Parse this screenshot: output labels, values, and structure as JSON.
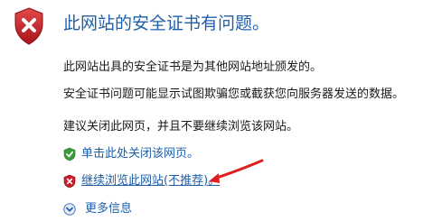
{
  "dialog": {
    "heading": "此网站的安全证书有问题。",
    "paragraphs": [
      "此网站出具的安全证书是为其他网站地址颁发的。",
      "安全证书问题可能显示试图欺骗您或截获您向服务器发送的数据。",
      "建议关闭此网页，并且不要继续浏览该网站。"
    ],
    "links": {
      "close_page": "单击此处关闭该网页。",
      "continue_site": "继续浏览此网站(不推荐)。",
      "more_info": "更多信息"
    }
  },
  "icons": {
    "banner": "shield-error-icon",
    "close_link": "shield-check-icon",
    "continue_link": "shield-error-small-icon",
    "more_info": "chevron-down-circle-icon",
    "annotation": "red-arrow-annotation"
  },
  "colors": {
    "link": "#1f5fa8",
    "heading": "#1f5fa8",
    "error_red": "#c8202a",
    "check_green": "#3a9a3a",
    "annotation_red": "#e02020"
  }
}
